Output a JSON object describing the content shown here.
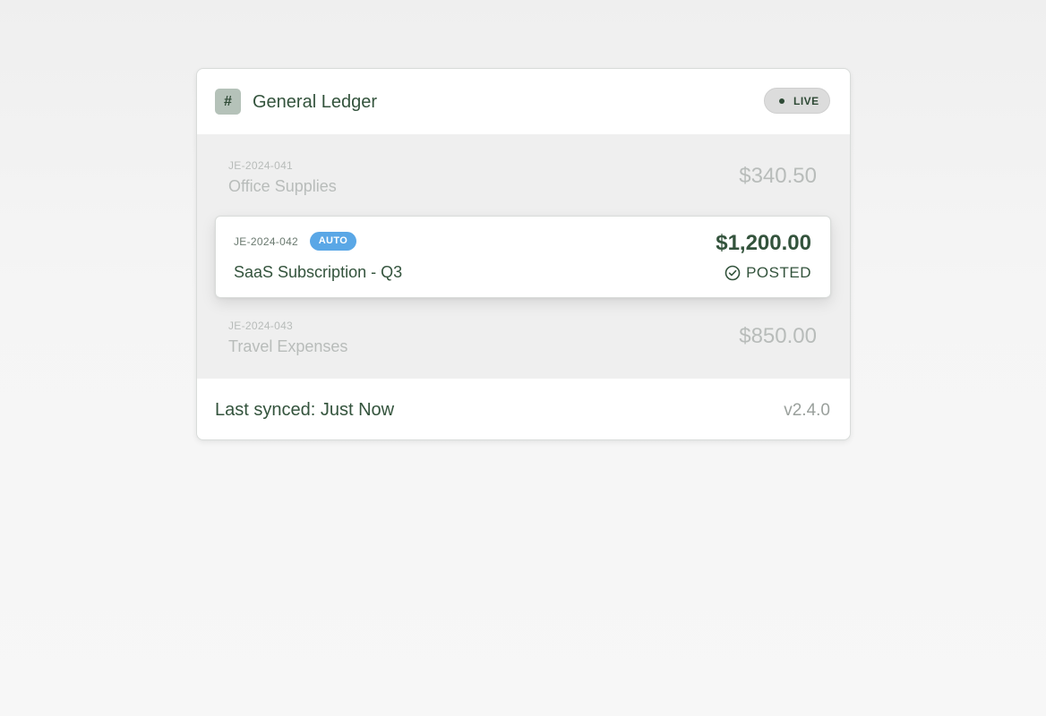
{
  "header": {
    "icon_glyph": "#",
    "icon": "hash-icon",
    "title": "General Ledger",
    "status_badge": "LIVE"
  },
  "entries": [
    {
      "id": "JE-2024-041",
      "description": "Office Supplies",
      "amount": "$340.50",
      "state": "muted"
    },
    {
      "id": "JE-2024-042",
      "badge": "AUTO",
      "description": "SaaS Subscription - Q3",
      "amount": "$1,200.00",
      "status": "POSTED",
      "status_icon": "check-circle-icon",
      "state": "active"
    },
    {
      "id": "JE-2024-043",
      "description": "Travel Expenses",
      "amount": "$850.00",
      "state": "muted"
    }
  ],
  "footer": {
    "sync_text": "Last synced: Just Now",
    "version": "v2.4.0"
  },
  "colors": {
    "primary_text": "#33533c",
    "muted_text": "#b8bcba",
    "auto_badge": "#5aa7e6",
    "icon_bg": "#b5c2b9",
    "list_bg": "#efefef"
  }
}
